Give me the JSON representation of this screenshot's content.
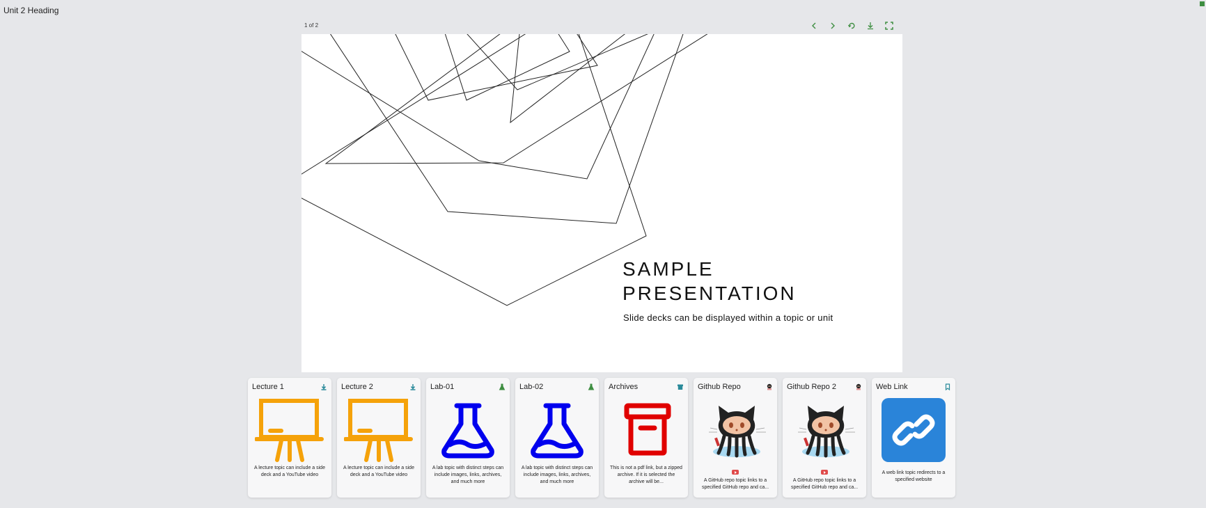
{
  "page": {
    "heading": "Unit 2 Heading"
  },
  "viewer": {
    "page_count": "1 of 2",
    "toolbar": [
      {
        "name": "previous-page-button",
        "icon": "chevron-left-icon"
      },
      {
        "name": "next-page-button",
        "icon": "chevron-right-icon"
      },
      {
        "name": "rotate-button",
        "icon": "rotate-icon"
      },
      {
        "name": "download-button",
        "icon": "download-icon"
      },
      {
        "name": "fullscreen-button",
        "icon": "fullscreen-icon"
      }
    ],
    "icon_color": "#3e8e41"
  },
  "slide": {
    "title": "SAMPLE\nPRESENTATION",
    "subtitle": "Slide decks can be displayed within a topic or unit"
  },
  "topics": [
    {
      "title": "Lecture 1",
      "badge": "download-icon",
      "image": "easel-icon",
      "desc": "A lecture topic can include a side deck and a YouTube video",
      "color": "#f5a20a"
    },
    {
      "title": "Lecture 2",
      "badge": "download-icon",
      "image": "easel-icon",
      "desc": "A lecture topic can include a side deck and a YouTube video",
      "color": "#f5a20a"
    },
    {
      "title": "Lab-01",
      "badge": "flask-small-icon",
      "image": "flask-icon",
      "desc": "A lab topic with distinct steps can include images, links, archives, and much more",
      "color": "#0000ee"
    },
    {
      "title": "Lab-02",
      "badge": "flask-small-icon",
      "image": "flask-icon",
      "desc": "A lab topic with distinct steps can include images, links, archives, and much more",
      "color": "#0000ee"
    },
    {
      "title": "Archives",
      "badge": "archive-small-icon",
      "image": "archive-icon",
      "desc": "This is not a pdf link, but a zipped archive. If it is selected the archive will be...",
      "color": "#e00000"
    },
    {
      "title": "Github Repo",
      "badge": "github-small-icon",
      "image": "octocat-icon",
      "desc": "A GitHub repo topic links to a specified GitHub repo and ca...",
      "video": true
    },
    {
      "title": "Github Repo 2",
      "badge": "github-small-icon",
      "image": "octocat-icon",
      "desc": "A GitHub repo topic links to a specified GitHub repo and ca...",
      "video": true
    },
    {
      "title": "Web Link",
      "badge": "bookmark-icon",
      "image": "link-icon",
      "desc": "A web link topic redirects to a specified website",
      "color": "#2a84d9"
    }
  ]
}
